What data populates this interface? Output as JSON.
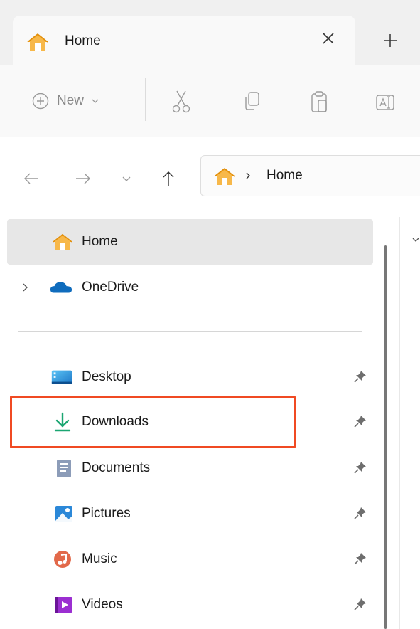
{
  "tab": {
    "title": "Home",
    "close_icon": "close-icon",
    "new_tab_icon": "plus-icon"
  },
  "command_bar": {
    "new_label": "New",
    "icons": [
      "add-circle-icon",
      "chevron-down-icon",
      "cut-icon",
      "copy-icon",
      "paste-icon",
      "rename-icon"
    ]
  },
  "nav": {
    "icons": [
      "back-arrow-icon",
      "forward-arrow-icon",
      "recent-dropdown-icon",
      "up-arrow-icon"
    ]
  },
  "address": {
    "text": "Home"
  },
  "sidebar": {
    "items": [
      {
        "label": "Home",
        "icon": "home-icon",
        "selected": true
      },
      {
        "label": "OneDrive",
        "icon": "onedrive-cloud-icon",
        "expandable": true
      },
      {
        "label": "Desktop",
        "icon": "desktop-icon",
        "pinned": true
      },
      {
        "label": "Downloads",
        "icon": "download-arrow-icon",
        "pinned": true,
        "highlighted": true
      },
      {
        "label": "Documents",
        "icon": "documents-icon",
        "pinned": true
      },
      {
        "label": "Pictures",
        "icon": "pictures-icon",
        "pinned": true
      },
      {
        "label": "Music",
        "icon": "music-icon",
        "pinned": true
      },
      {
        "label": "Videos",
        "icon": "videos-icon",
        "pinned": true
      }
    ]
  },
  "colors": {
    "highlight": "#f04a23",
    "selected_bg": "#e7e7e7",
    "home_orange": "#f5a623",
    "onedrive_blue": "#0f6cbd",
    "downloads_green": "#1ba672"
  }
}
